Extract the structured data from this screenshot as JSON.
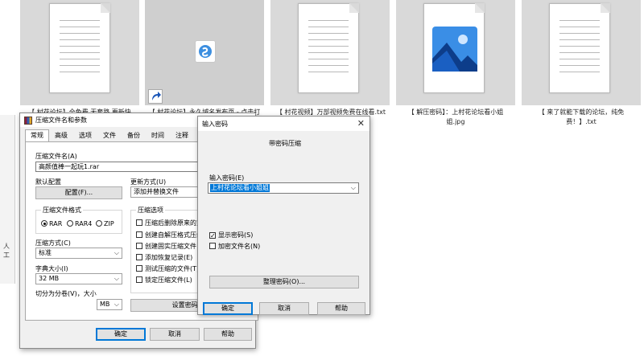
{
  "files": [
    {
      "caption": "【 村花论坛】全免费 无套路 更新快"
    },
    {
      "caption": "【 村花论坛】永久域名发布页 - 点击打开"
    },
    {
      "caption": "【 村花视频】万部视频免费在线看.txt"
    },
    {
      "caption": "【 解压密码】：上村花论坛看小姐姐.jpg"
    },
    {
      "caption": "【 来了就能下载的论坛，纯免费！】.txt"
    }
  ],
  "left_strip": {
    "text": "人工"
  },
  "archive_dialog": {
    "title": "压缩文件名和参数",
    "tabs": [
      "常规",
      "高级",
      "选项",
      "文件",
      "备份",
      "时间",
      "注释"
    ],
    "archive_name_label": "压缩文件名(A)",
    "archive_name_value": "高颜值棒一起玩1.rar",
    "default_profile_label": "默认配置",
    "profile_button": "配置(F)...",
    "update_mode_label": "更新方式(U)",
    "update_mode_value": "添加并替换文件",
    "format_group_label": "压缩文件格式",
    "format_rar": "RAR",
    "format_rar4": "RAR4",
    "format_zip": "ZIP",
    "options_group_label": "压缩选项",
    "options": [
      {
        "label": "压缩后删除原来的文件",
        "checked": false
      },
      {
        "label": "创建自解压格式压缩文件",
        "checked": false
      },
      {
        "label": "创建固实压缩文件",
        "checked": false
      },
      {
        "label": "添加恢复记录(E)",
        "checked": false
      },
      {
        "label": "测试压缩的文件(T)",
        "checked": false
      },
      {
        "label": "锁定压缩文件(L)",
        "checked": false
      }
    ],
    "method_label": "压缩方式(C)",
    "method_value": "标准",
    "dict_label": "字典大小(I)",
    "dict_value": "32 MB",
    "split_label": "切分为分卷(V)，大小",
    "split_unit": "MB",
    "set_password_button": "设置密码(P)...",
    "ok": "确定",
    "cancel": "取消",
    "help": "帮助"
  },
  "password_dialog": {
    "title": "输入密码",
    "header": "带密码压缩",
    "input_label": "输入密码(E)",
    "input_value": "上村花论坛看小姐姐",
    "show_password_label": "显示密码(S)",
    "show_password_checked": true,
    "encrypt_names_label": "加密文件名(N)",
    "encrypt_names_checked": false,
    "organize_button": "整理密码(O)...",
    "ok": "确定",
    "cancel": "取消",
    "help": "帮助"
  },
  "colors": {
    "selection": "#0078d7",
    "dialog_bg": "#f0f0f0",
    "tile_bg": "#d9d9d9"
  },
  "icons": [
    "document-icon",
    "shortcut-arrow-icon",
    "image-file-icon",
    "winrar-icon",
    "close-icon",
    "chevron-down-icon"
  ]
}
